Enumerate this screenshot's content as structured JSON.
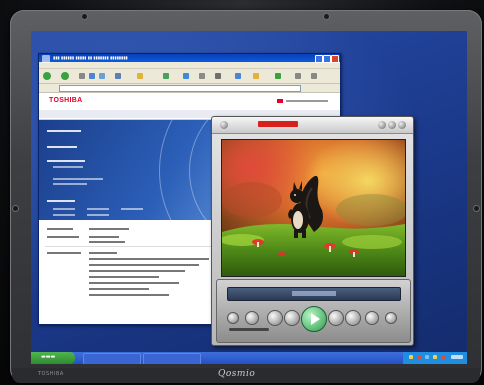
{
  "device": {
    "brand_logo": "Qosmio",
    "model_text": "TOSHIBA"
  },
  "browser": {
    "site_logo": "TOSHIBA"
  },
  "colors": {
    "desktop_blue": "#1f3f95",
    "taskbar_blue": "#2451c4",
    "start_green": "#2f8a2f",
    "toshiba_red": "#e4002b",
    "play_green": "#2a9c4a"
  },
  "icons": [
    "back-icon",
    "forward-icon",
    "home-icon",
    "search-icon",
    "favorites-icon",
    "play-icon",
    "stop-icon",
    "prev-icon",
    "next-icon"
  ]
}
